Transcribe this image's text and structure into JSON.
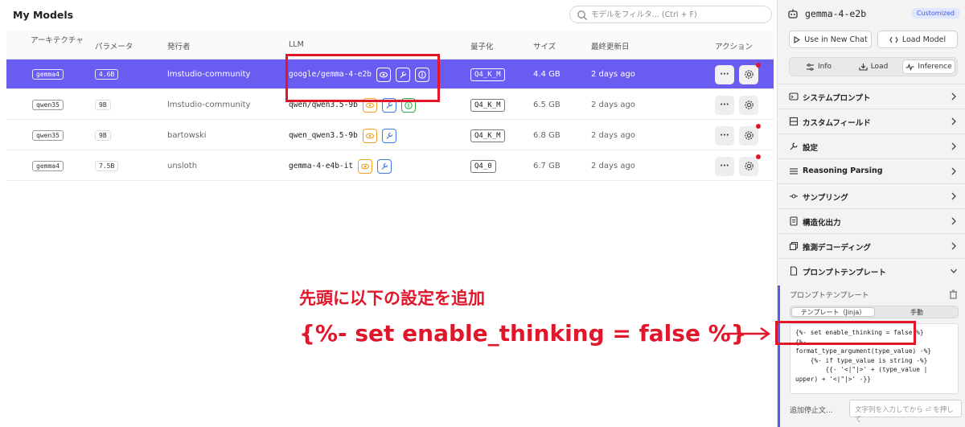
{
  "header": {
    "title": "My Models",
    "search_placeholder": "モデルをフィルタ... (Ctrl + F)"
  },
  "table": {
    "columns": {
      "arch": "アーキテクチャ",
      "params": "パラメータ",
      "publisher": "発行者",
      "llm": "LLM",
      "quant": "量子化",
      "size": "サイズ",
      "modified": "最終更新日",
      "actions": "アクション"
    },
    "rows": [
      {
        "arch": "gemma4",
        "params": "4.6B",
        "publisher": "lmstudio-community",
        "llm": "google/gemma-4-e2b",
        "quant": "Q4_K_M",
        "size": "4.4 GB",
        "modified": "2 days ago",
        "more": "···"
      },
      {
        "arch": "qwen35",
        "params": "9B",
        "publisher": "lmstudio-community",
        "llm": "qwen/qwen3.5-9b",
        "quant": "Q4_K_M",
        "size": "6.5 GB",
        "modified": "2 days ago",
        "more": "···"
      },
      {
        "arch": "qwen35",
        "params": "9B",
        "publisher": "bartowski",
        "llm": "qwen_qwen3.5-9b",
        "quant": "Q4_K_M",
        "size": "6.8 GB",
        "modified": "2 days ago",
        "more": "···"
      },
      {
        "arch": "gemma4",
        "params": "7.5B",
        "publisher": "unsloth",
        "llm": "gemma-4-e4b-it",
        "quant": "Q4_0",
        "size": "6.7 GB",
        "modified": "2 days ago",
        "more": "···"
      }
    ]
  },
  "annotation": {
    "line1": "先頭に以下の設定を追加",
    "line2": "{%- set enable_thinking = false %}"
  },
  "sidebar": {
    "model_name": "gemma-4-e2b",
    "badge": "Customized",
    "use_in_chat": "Use in New Chat",
    "load_model": "Load Model",
    "tabs": [
      "Info",
      "Load",
      "Inference"
    ],
    "sections": [
      "システムプロンプト",
      "カスタムフィールド",
      "設定",
      "Reasoning Parsing",
      "サンプリング",
      "構造化出力",
      "推測デコーディング",
      "プロンプトテンプレート"
    ],
    "template": {
      "label": "プロンプトテンプレート",
      "mode_jinja": "テンプレート（Jinja）",
      "mode_manual": "手動",
      "code": "{%- set enable_thinking = false %}\n{%- ...\nformat_type_argument(type_value) -%}\n    {%- if type_value is string -%}\n        {{- '<|\"|>' + (type_value |\nupper) + '<|\"|>' -}}",
      "stop_label": "追加停止文...",
      "stop_placeholder": "文字列を入力してから ⏎ を押して"
    }
  },
  "colors": {
    "accent": "#6a5cf0",
    "annotation": "#e0162b"
  }
}
